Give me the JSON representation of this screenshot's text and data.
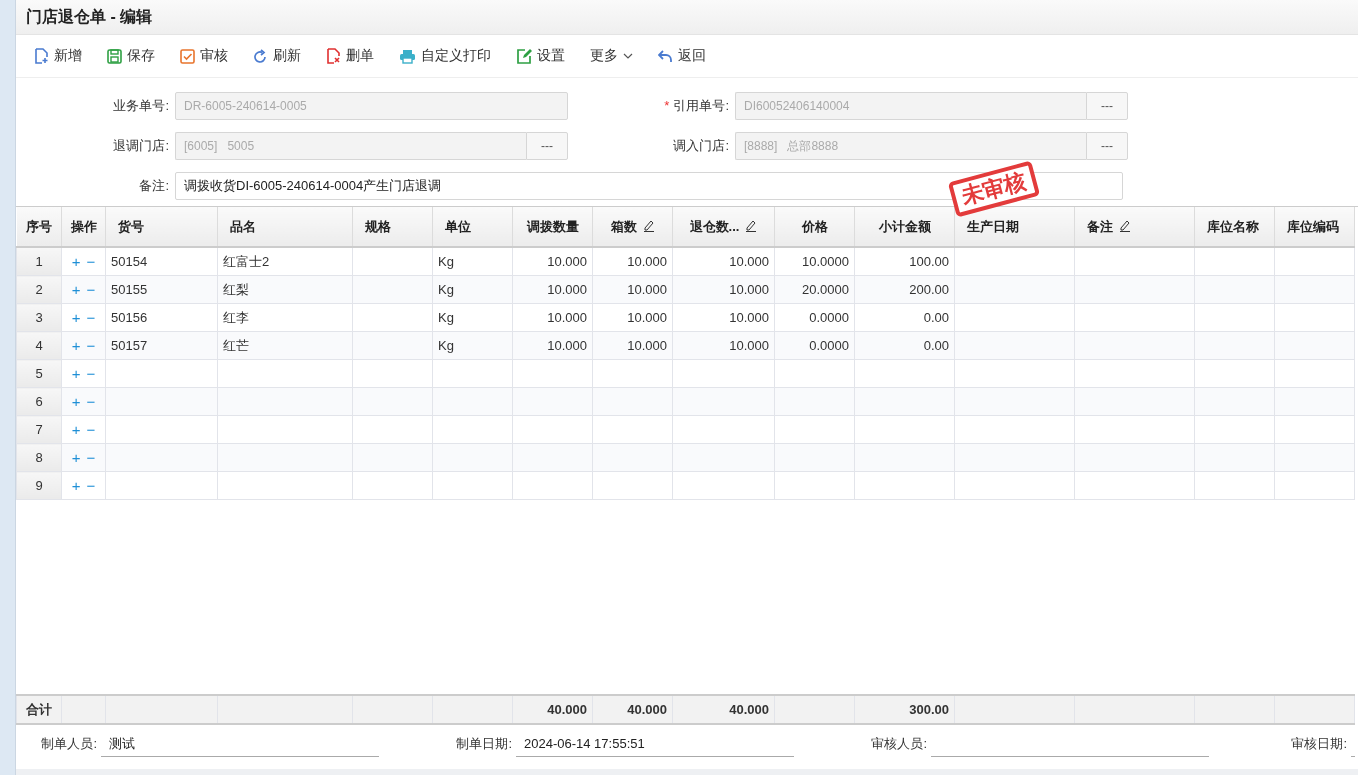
{
  "window": {
    "title": "门店退仓单 - 编辑"
  },
  "toolbar": [
    {
      "kind": "new",
      "label": "新增"
    },
    {
      "kind": "save",
      "label": "保存"
    },
    {
      "kind": "audit",
      "label": "审核"
    },
    {
      "kind": "refresh",
      "label": "刷新"
    },
    {
      "kind": "delete",
      "label": "删单"
    },
    {
      "kind": "print",
      "label": "自定义打印"
    },
    {
      "kind": "settings",
      "label": "设置"
    },
    {
      "kind": "more",
      "label": "更多"
    },
    {
      "kind": "back",
      "label": "返回"
    }
  ],
  "form": {
    "business_no": {
      "label": "业务单号:",
      "value": "DR-6005-240614-0005",
      "disabled": true
    },
    "reference_no": {
      "label": "引用单号:",
      "required_mark": "*",
      "value": "DI60052406140004",
      "disabled": true,
      "picker": "---"
    },
    "out_store": {
      "label": "退调门店:",
      "code": "[6005]",
      "value": "5005",
      "disabled": true,
      "picker": "---"
    },
    "in_store": {
      "label": "调入门店:",
      "code": "[8888]",
      "value": "总部8888",
      "disabled": true,
      "picker": "---"
    },
    "remark": {
      "label": "备注:",
      "value": "调拨收货DI-6005-240614-0004产生门店退调"
    }
  },
  "stamp": {
    "text": "未审核"
  },
  "table": {
    "columns": [
      {
        "label": "序号",
        "kind": "index",
        "editable": false
      },
      {
        "label": "操作",
        "kind": "actions",
        "editable": false
      },
      {
        "label": "货号",
        "kind": "text",
        "editable": false
      },
      {
        "label": "品名",
        "kind": "text",
        "editable": false
      },
      {
        "label": "规格",
        "kind": "text",
        "editable": false
      },
      {
        "label": "单位",
        "kind": "text",
        "editable": false
      },
      {
        "label": "调拨数量",
        "kind": "number",
        "editable": false
      },
      {
        "label": "箱数",
        "kind": "number",
        "editable": true
      },
      {
        "label": "退仓数...",
        "kind": "number",
        "editable": true
      },
      {
        "label": "价格",
        "kind": "number",
        "editable": false
      },
      {
        "label": "小计金额",
        "kind": "number",
        "editable": false
      },
      {
        "label": "生产日期",
        "kind": "text",
        "editable": false
      },
      {
        "label": "备注",
        "kind": "text",
        "editable": true
      },
      {
        "label": "库位名称",
        "kind": "text",
        "editable": false
      },
      {
        "label": "库位编码",
        "kind": "text",
        "editable": false
      }
    ],
    "rows": [
      {
        "no": "1",
        "actions": [
          "+",
          "−"
        ],
        "cells": [
          "50154",
          "红富士2",
          null,
          "Kg",
          "10.000",
          "10.000",
          "10.000",
          "10.0000",
          "100.00",
          null,
          null,
          null,
          null
        ]
      },
      {
        "no": "2",
        "actions": [
          "+",
          "−"
        ],
        "cells": [
          "50155",
          "红梨",
          null,
          "Kg",
          "10.000",
          "10.000",
          "10.000",
          "20.0000",
          "200.00",
          null,
          null,
          null,
          null
        ]
      },
      {
        "no": "3",
        "actions": [
          "+",
          "−"
        ],
        "cells": [
          "50156",
          "红李",
          null,
          "Kg",
          "10.000",
          "10.000",
          "10.000",
          "0.0000",
          "0.00",
          null,
          null,
          null,
          null
        ]
      },
      {
        "no": "4",
        "actions": [
          "+",
          "−"
        ],
        "cells": [
          "50157",
          "红芒",
          null,
          "Kg",
          "10.000",
          "10.000",
          "10.000",
          "0.0000",
          "0.00",
          null,
          null,
          null,
          null
        ]
      },
      {
        "no": "5",
        "actions": [
          "+",
          "−"
        ]
      },
      {
        "no": "6",
        "actions": [
          "+",
          "−"
        ]
      },
      {
        "no": "7",
        "actions": [
          "+",
          "−"
        ]
      },
      {
        "no": "8",
        "actions": [
          "+",
          "−"
        ]
      },
      {
        "no": "9",
        "actions": [
          "+",
          "−"
        ]
      }
    ],
    "totals": {
      "label": "合计",
      "cells": [
        null,
        null,
        null,
        null,
        null,
        null,
        "40.000",
        "40.000",
        "40.000",
        null,
        "300.00",
        null,
        null,
        null,
        null
      ]
    }
  },
  "footer": [
    {
      "label": "制单人员:",
      "value": "测试"
    },
    {
      "label": "制单日期:",
      "value": "2024-06-14 17:55:51"
    },
    {
      "label": "审核人员:"
    },
    {
      "label": "审核日期:"
    }
  ]
}
